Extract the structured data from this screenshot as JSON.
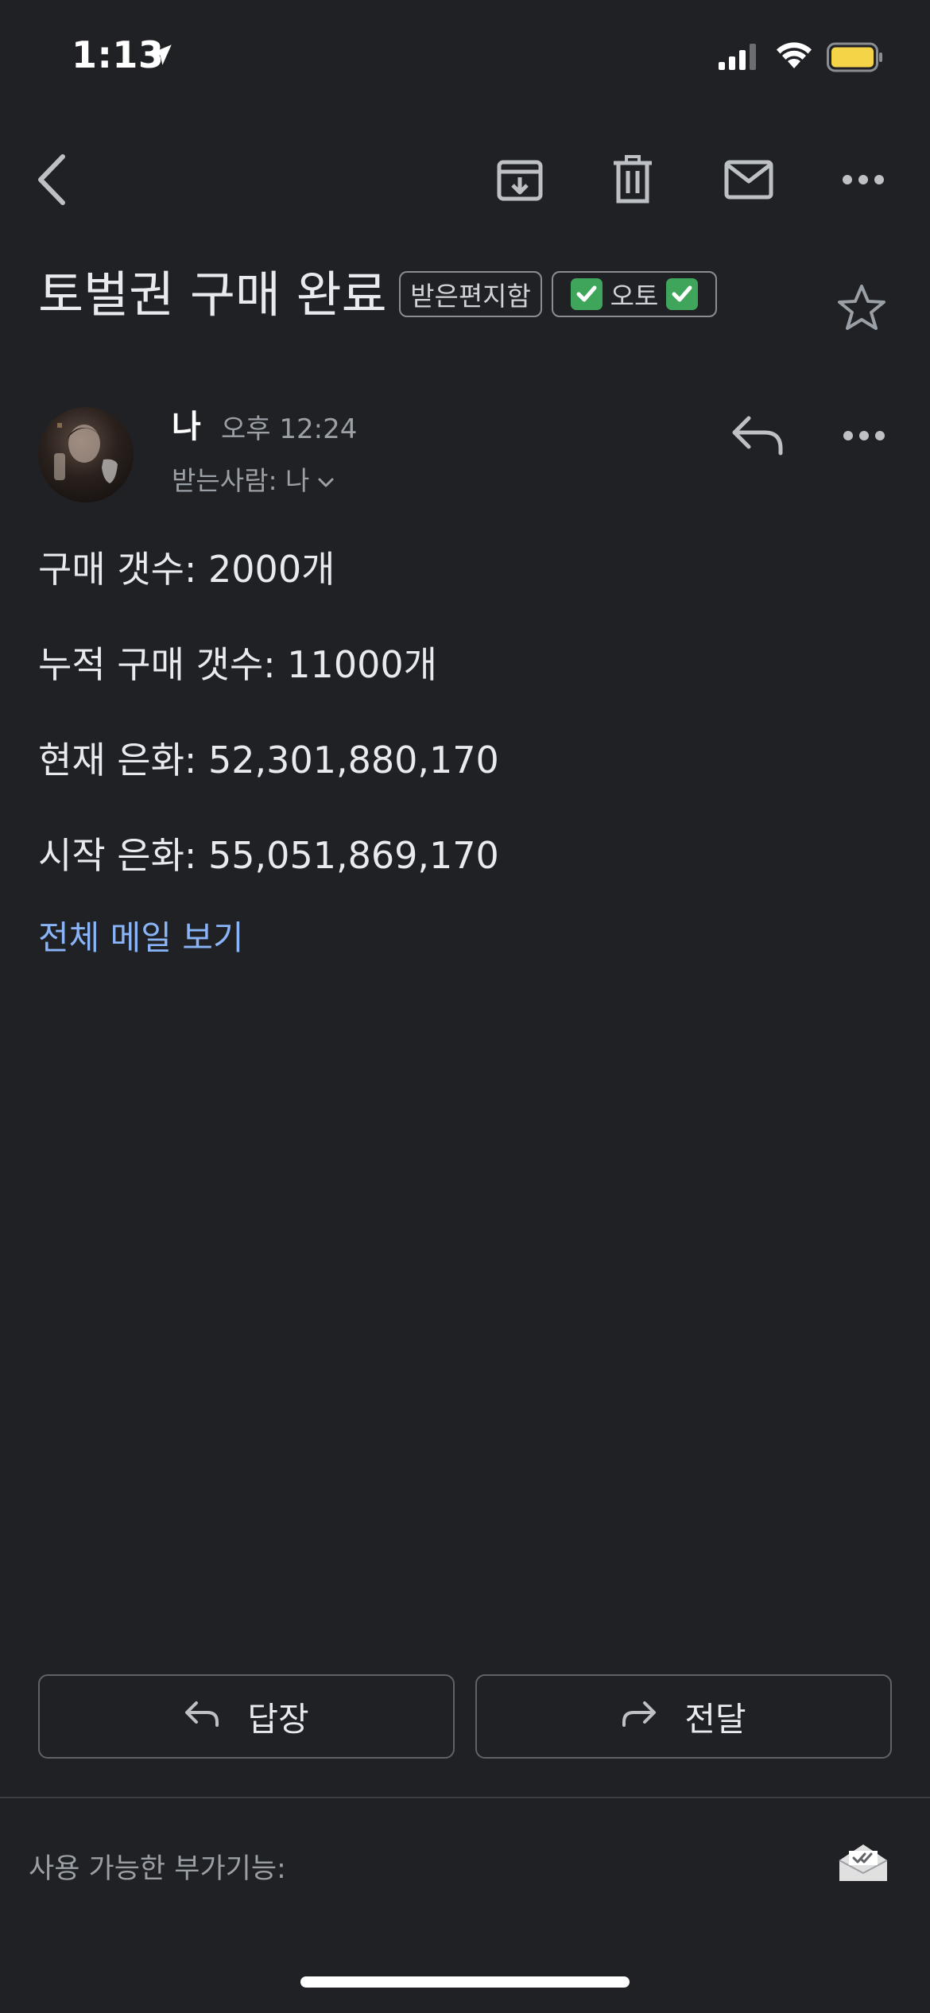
{
  "status_bar": {
    "time": "1:13"
  },
  "toolbar": {
    "icons": [
      "back-arrow-icon",
      "archive-icon",
      "trash-icon",
      "mail-icon",
      "more-icon"
    ]
  },
  "email": {
    "subject": "토벌권 구매 완료",
    "labels": {
      "inbox": "받은편지함",
      "auto": "오토"
    },
    "sender": {
      "name": "나",
      "time": "오후 12:24",
      "recipient": "받는사람: 나"
    },
    "body_lines": [
      "구매 갯수: 2000개",
      "누적 구매 갯수: 11000개",
      "현재 은화: 52,301,880,170",
      "시작 은화: 55,051,869,170"
    ],
    "view_full": "전체 메일 보기"
  },
  "actions": {
    "reply": "답장",
    "forward": "전달"
  },
  "footer": {
    "addons_label": "사용 가능한 부가기능:"
  },
  "colors": {
    "background": "#202124",
    "link": "#8ab4f8",
    "battery": "#f5d547",
    "check": "#3ea55b"
  }
}
